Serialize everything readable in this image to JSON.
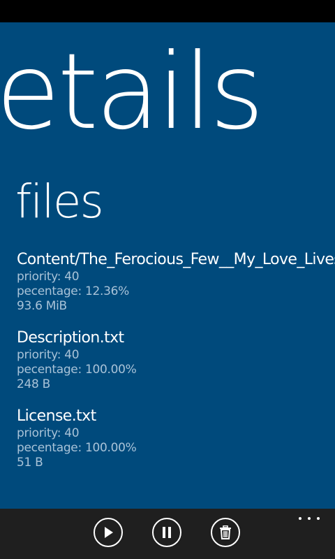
{
  "page": {
    "title": "etails",
    "section_header": "files"
  },
  "files": [
    {
      "name": "Content/The_Ferocious_Few__My_Love_Lives_In_The_Street",
      "priority": "priority: 40",
      "percentage": "pecentage: 12.36%",
      "size": "93.6 MiB"
    },
    {
      "name": "Description.txt",
      "priority": "priority: 40",
      "percentage": "pecentage: 100.00%",
      "size": "248 B"
    },
    {
      "name": "License.txt",
      "priority": "priority: 40",
      "percentage": "pecentage: 100.00%",
      "size": "51 B"
    }
  ],
  "app_bar": {
    "buttons": [
      {
        "icon": "play-icon"
      },
      {
        "icon": "pause-icon"
      },
      {
        "icon": "delete-icon"
      }
    ],
    "more_icon": "ellipsis-icon"
  },
  "colors": {
    "background": "#004a7c",
    "app_bar": "#1f1f1f",
    "secondary_text": "#a9c3d8"
  }
}
